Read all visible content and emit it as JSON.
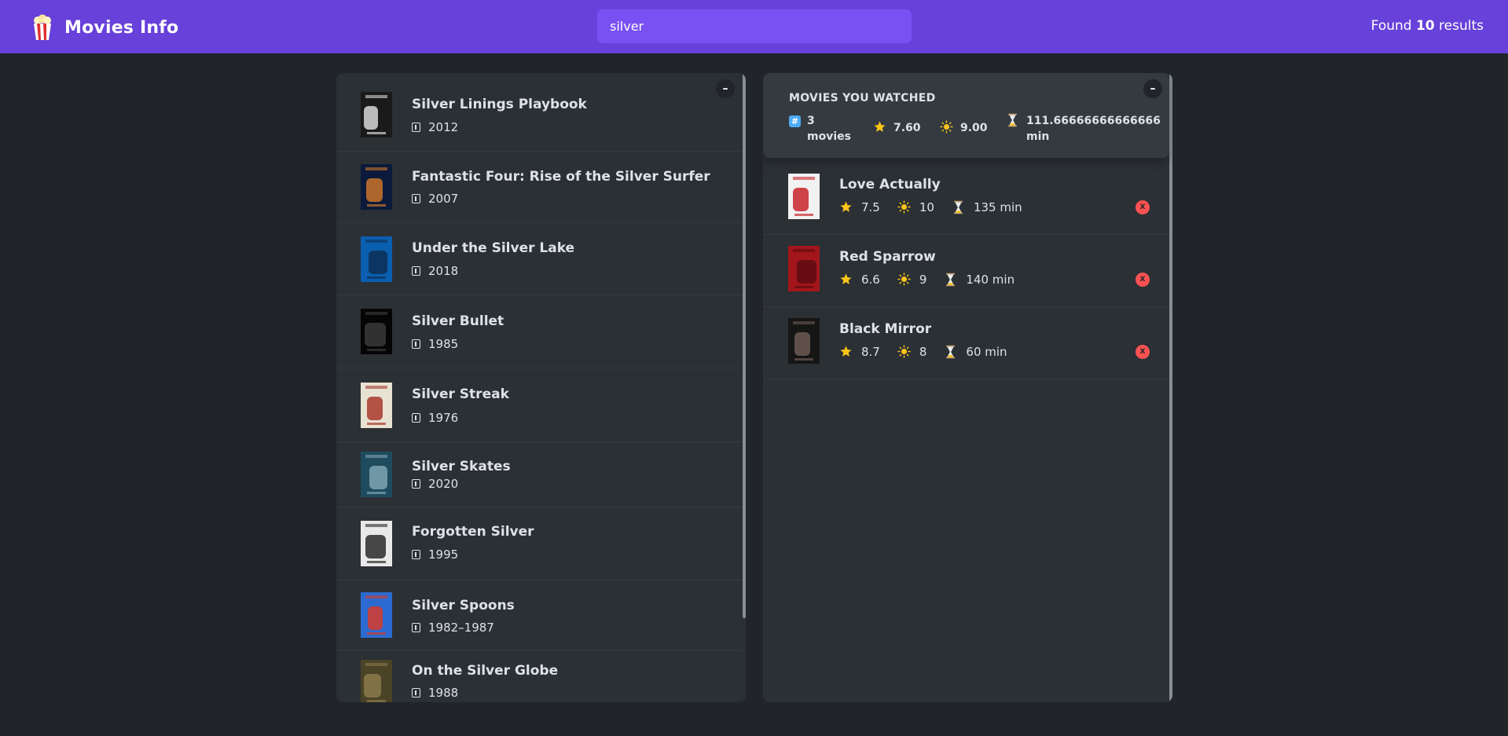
{
  "app": {
    "title": "Movies Info",
    "logo_icon": "popcorn-icon"
  },
  "search": {
    "value": "silver",
    "placeholder": "Search movies..."
  },
  "results": {
    "prefix": "Found",
    "count": "10",
    "suffix": "results"
  },
  "list_toggle_label": "–",
  "movies": [
    {
      "title": "Silver Linings Playbook",
      "year": "2012",
      "poster_colors": [
        "#1a1a1a",
        "#d8d8d8"
      ]
    },
    {
      "title": "Fantastic Four: Rise of the Silver Surfer",
      "year": "2007",
      "poster_colors": [
        "#0b1a3a",
        "#c9742a"
      ]
    },
    {
      "title": "Under the Silver Lake",
      "year": "2018",
      "poster_colors": [
        "#0a5fb0",
        "#0d2f55"
      ]
    },
    {
      "title": "Silver Bullet",
      "year": "1985",
      "poster_colors": [
        "#050505",
        "#3a3a3a"
      ]
    },
    {
      "title": "Silver Streak",
      "year": "1976",
      "poster_colors": [
        "#e8e2d2",
        "#a8392e"
      ]
    },
    {
      "title": "Silver Skates",
      "year": "2020",
      "poster_colors": [
        "#1f4b5e",
        "#7ea4b3"
      ]
    },
    {
      "title": "Forgotten Silver",
      "year": "1995",
      "poster_colors": [
        "#e9e9e9",
        "#2a2a2a"
      ]
    },
    {
      "title": "Silver Spoons",
      "year": "1982–1987",
      "poster_colors": [
        "#2b6bd1",
        "#d83a2a"
      ]
    },
    {
      "title": "On the Silver Globe",
      "year": "1988",
      "poster_colors": [
        "#4a4326",
        "#8a7a4a"
      ]
    }
  ],
  "summary": {
    "heading": "MOVIES YOU WATCHED",
    "count_line1": "3",
    "count_line2": "movies",
    "imdb_avg": "7.60",
    "user_avg": "9.00",
    "runtime_line1": "111.66666666666666",
    "runtime_line2": "min",
    "toggle_label": "–"
  },
  "watched": [
    {
      "title": "Love Actually",
      "imdb": "7.5",
      "user": "10",
      "runtime": "135 min",
      "poster_colors": [
        "#f2f2f2",
        "#c8252b"
      ]
    },
    {
      "title": "Red Sparrow",
      "imdb": "6.6",
      "user": "9",
      "runtime": "140 min",
      "poster_colors": [
        "#a3161b",
        "#5e0c10"
      ]
    },
    {
      "title": "Black Mirror",
      "imdb": "8.7",
      "user": "8",
      "runtime": "60 min",
      "poster_colors": [
        "#151515",
        "#6b5a52"
      ]
    }
  ],
  "remove_label": "X",
  "colors": {
    "brand": "#6741d9",
    "search_bg": "#7950f2",
    "background": "#212529",
    "panel": "#2b3035",
    "summary_panel": "#343a40",
    "remove": "#fa5252",
    "star": "#fcc419"
  }
}
